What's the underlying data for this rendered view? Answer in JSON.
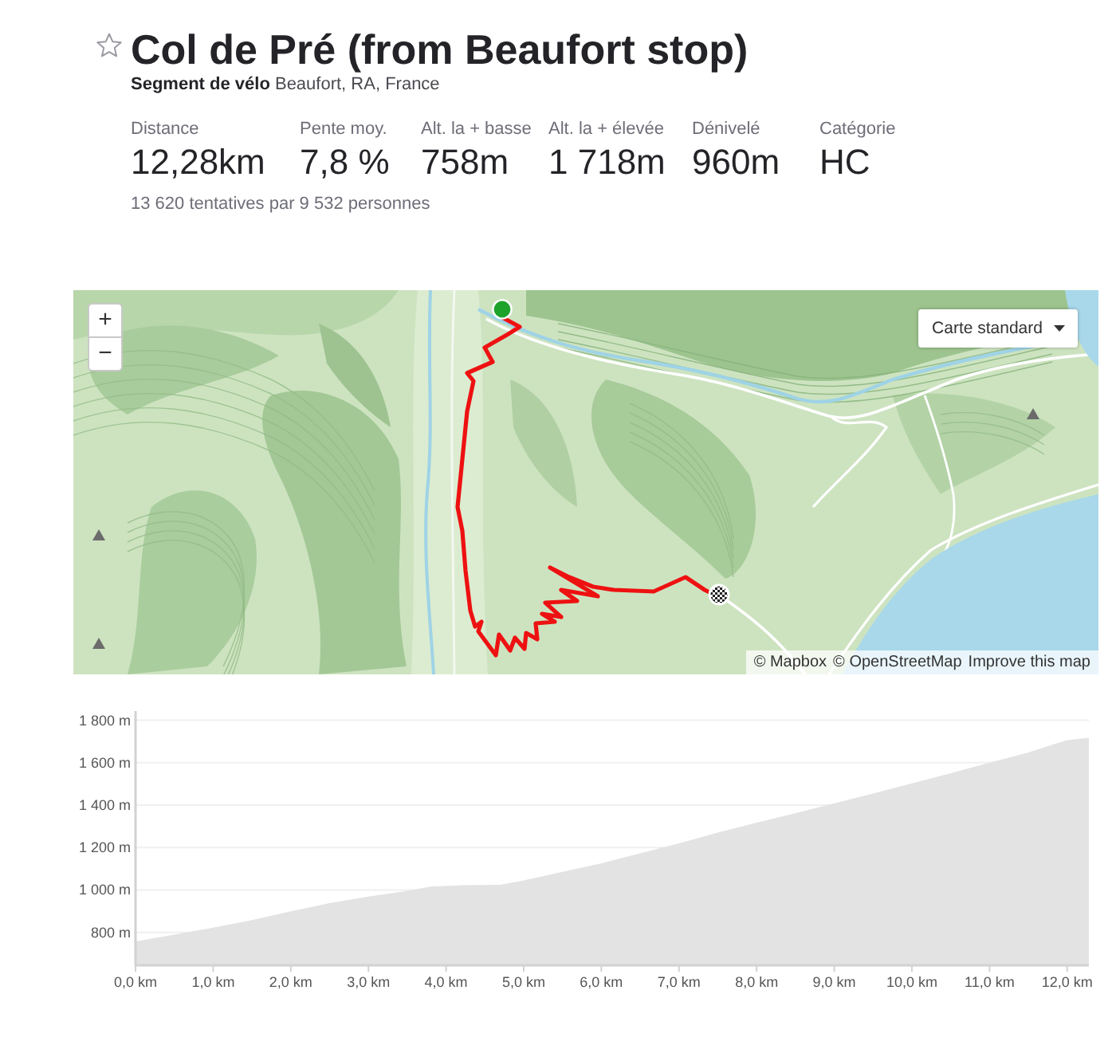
{
  "segment": {
    "starred": false,
    "title": "Col de Pré (from Beaufort stop)",
    "subtitle": "**Segment de vélo** Beaufort, RA, France"
  },
  "stats": [
    {
      "label": "Distance",
      "value": "12,28km"
    },
    {
      "label": "Pente moy.",
      "value": "7,8 %"
    },
    {
      "label": "Alt. la + basse",
      "value": "758m"
    },
    {
      "label": "Alt. la + élevée",
      "value": "1 718m"
    },
    {
      "label": "Dénivelé",
      "value": "960m"
    },
    {
      "label": "Catégorie",
      "value": "HC"
    }
  ],
  "attempts": "13 620 tentatives par 9 532 personnes",
  "map": {
    "zoom_controls": [
      {
        "label": "+"
      },
      {
        "label": "−"
      }
    ],
    "style_menu": {
      "label": "Carte standard"
    },
    "attribution": [
      {
        "text": "© Mapbox"
      },
      {
        "text": "© OpenStreetMap"
      },
      {
        "text": "Improve this map"
      }
    ]
  },
  "elevation_profile": {
    "chart_data": {
      "type": "area",
      "grid": true,
      "x": [
        0,
        0.5,
        1,
        1.5,
        2,
        2.5,
        3,
        3.5,
        3.8,
        4.2,
        4.7,
        5,
        5.5,
        6,
        6.5,
        7,
        7.5,
        8,
        8.5,
        9,
        9.5,
        10,
        10.5,
        11,
        11.5,
        11.8,
        12,
        12.28
      ],
      "series": [
        {
          "color": "#e3e3e3",
          "values": [
            758,
            790,
            822,
            858,
            900,
            938,
            969,
            996,
            1016,
            1022,
            1024,
            1045,
            1085,
            1126,
            1172,
            1220,
            1270,
            1317,
            1362,
            1408,
            1455,
            1502,
            1550,
            1600,
            1648,
            1684,
            1706,
            1718
          ]
        }
      ],
      "xlim": [
        0,
        12.28
      ],
      "ylim": [
        645,
        1800
      ],
      "xticks": [
        {
          "value": 0,
          "label": "0,0 km"
        },
        {
          "value": 1,
          "label": "1,0 km"
        },
        {
          "value": 2,
          "label": "2,0 km"
        },
        {
          "value": 3,
          "label": "3,0 km"
        },
        {
          "value": 4,
          "label": "4,0 km"
        },
        {
          "value": 5,
          "label": "5,0 km"
        },
        {
          "value": 6,
          "label": "6,0 km"
        },
        {
          "value": 7,
          "label": "7,0 km"
        },
        {
          "value": 8,
          "label": "8,0 km"
        },
        {
          "value": 9,
          "label": "9,0 km"
        },
        {
          "value": 10,
          "label": "10,0 km"
        },
        {
          "value": 11,
          "label": "11,0 km"
        },
        {
          "value": 12,
          "label": "12,0 km"
        }
      ],
      "yticks": [
        {
          "value": 800,
          "label": "800 m"
        },
        {
          "value": 1000,
          "label": "1 000 m"
        },
        {
          "value": 1200,
          "label": "1 200 m"
        },
        {
          "value": 1400,
          "label": "1 400 m"
        },
        {
          "value": 1600,
          "label": "1 600 m"
        },
        {
          "value": 1800,
          "label": "1 800 m"
        }
      ]
    }
  }
}
